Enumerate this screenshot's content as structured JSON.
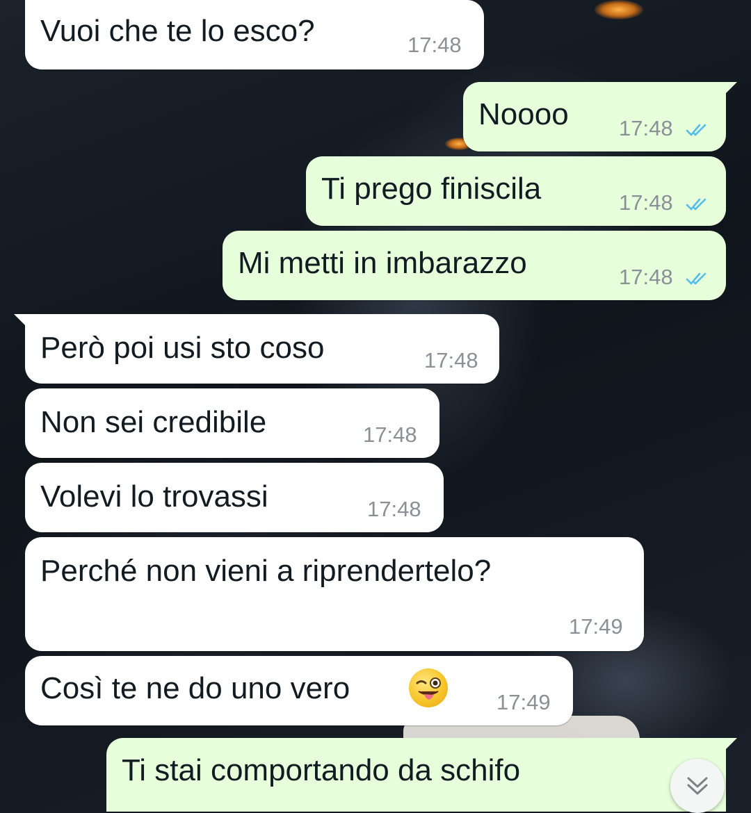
{
  "messages": [
    {
      "direction": "in",
      "text": "Vuoi che te lo esco?",
      "time": "17:48"
    },
    {
      "direction": "out",
      "text": "Noooo",
      "time": "17:48",
      "status": "read"
    },
    {
      "direction": "out",
      "text": "Ti prego finiscila",
      "time": "17:48",
      "status": "read"
    },
    {
      "direction": "out",
      "text": "Mi metti in imbarazzo",
      "time": "17:48",
      "status": "read"
    },
    {
      "direction": "in",
      "text": "Però poi usi sto coso",
      "time": "17:48"
    },
    {
      "direction": "in",
      "text": "Non sei credibile",
      "time": "17:48"
    },
    {
      "direction": "in",
      "text": "Volevi lo trovassi",
      "time": "17:48"
    },
    {
      "direction": "in",
      "text": "Perché non vieni a riprendertelo?",
      "time": "17:49"
    },
    {
      "direction": "in",
      "text": "Così te ne do uno vero",
      "time": "17:49",
      "emoji": "winking-face-with-tongue"
    },
    {
      "direction": "out",
      "text": "Ti stai comportando da schifo",
      "time": ""
    }
  ],
  "icons": {
    "read_ticks": "double-check-icon",
    "scroll_down": "chevron-double-down-icon"
  },
  "colors": {
    "incoming_bubble": "#ffffff",
    "outgoing_bubble": "#e7ffdb",
    "read_tick": "#53bdeb",
    "timestamp": "#8a9096"
  }
}
